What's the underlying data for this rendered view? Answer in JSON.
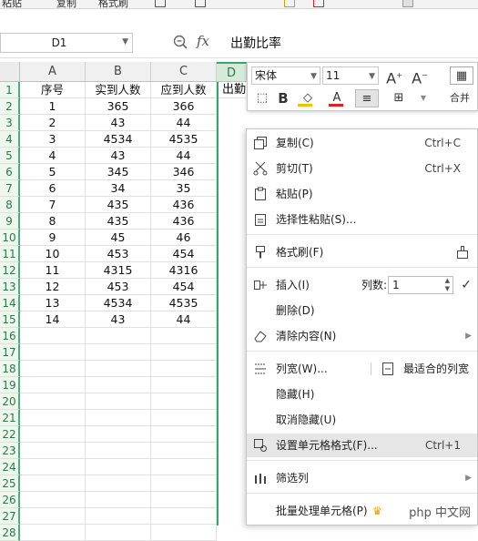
{
  "toolbar": {
    "paste_label": "粘贴",
    "copy_label": "复制",
    "format_painter_label": "格式刷"
  },
  "name_box": {
    "value": "D1"
  },
  "formula_bar": {
    "fx_label": "fx",
    "value": "出勤比率"
  },
  "columns": [
    "A",
    "B",
    "C"
  ],
  "partial_column": "D",
  "row_numbers": [
    "1",
    "2",
    "3",
    "4",
    "5",
    "6",
    "7",
    "8",
    "9",
    "10",
    "11",
    "12",
    "13",
    "14",
    "15",
    "16",
    "17",
    "18",
    "19",
    "20",
    "21",
    "22",
    "23",
    "24",
    "25",
    "26",
    "27",
    "28"
  ],
  "sheet": {
    "header": [
      "序号",
      "实到人数",
      "应到人数"
    ],
    "d1_partial": "出勤",
    "rows": [
      [
        "1",
        "365",
        "366"
      ],
      [
        "2",
        "43",
        "44"
      ],
      [
        "3",
        "4534",
        "4535"
      ],
      [
        "4",
        "43",
        "44"
      ],
      [
        "5",
        "345",
        "346"
      ],
      [
        "6",
        "34",
        "35"
      ],
      [
        "7",
        "435",
        "436"
      ],
      [
        "8",
        "435",
        "436"
      ],
      [
        "9",
        "45",
        "46"
      ],
      [
        "10",
        "453",
        "454"
      ],
      [
        "11",
        "4315",
        "4316"
      ],
      [
        "12",
        "453",
        "454"
      ],
      [
        "13",
        "4534",
        "4535"
      ],
      [
        "14",
        "43",
        "44"
      ]
    ]
  },
  "mini_toolbar": {
    "font_name": "宋体",
    "font_size": "11",
    "bold": "B",
    "font_color": "A",
    "merge_label": "合并"
  },
  "context_menu": {
    "copy": "复制(C)",
    "copy_shortcut": "Ctrl+C",
    "cut": "剪切(T)",
    "cut_shortcut": "Ctrl+X",
    "paste": "粘贴(P)",
    "paste_special": "选择性粘贴(S)...",
    "format_painter": "格式刷(F)",
    "insert": "插入(I)",
    "column_count_label": "列数:",
    "column_count_value": "1",
    "delete": "删除(D)",
    "clear_contents": "清除内容(N)",
    "column_width": "列宽(W)...",
    "best_fit": "最适合的列宽",
    "hide": "隐藏(H)",
    "unhide": "取消隐藏(U)",
    "format_cells": "设置单元格格式(F)...",
    "format_cells_shortcut": "Ctrl+1",
    "filter_column": "筛选列",
    "batch_process": "批量处理单元格(P)"
  },
  "watermark": "php 中文网",
  "colors": {
    "accent_green": "#3aa46c",
    "highlight": "#e6e6e6",
    "font_color_red": "#e02020"
  }
}
